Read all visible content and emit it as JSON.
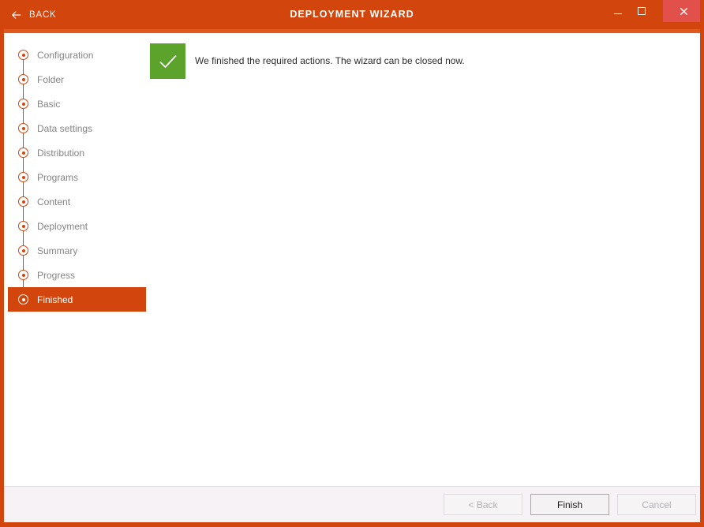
{
  "titlebar": {
    "back_label": "BACK",
    "back_icon": "arrow-left-icon",
    "title": "DEPLOYMENT WIZARD",
    "minimize_icon": "minimize-icon",
    "maximize_icon": "maximize-icon",
    "close_icon": "close-icon",
    "bg_color": "#d2450c",
    "close_bg_color": "#e2504c"
  },
  "sidebar": {
    "steps": [
      {
        "label": "Configuration",
        "active": false
      },
      {
        "label": "Folder",
        "active": false
      },
      {
        "label": "Basic",
        "active": false
      },
      {
        "label": "Data settings",
        "active": false
      },
      {
        "label": "Distribution",
        "active": false
      },
      {
        "label": "Programs",
        "active": false
      },
      {
        "label": "Content",
        "active": false
      },
      {
        "label": "Deployment",
        "active": false
      },
      {
        "label": "Summary",
        "active": false
      },
      {
        "label": "Progress",
        "active": false
      },
      {
        "label": "Finished",
        "active": true
      }
    ],
    "accent_color": "#d2450c",
    "inactive_text_color": "#848484"
  },
  "main": {
    "status_icon": "checkmark-icon",
    "status_color": "#5ba32b",
    "message": "We finished the required actions. The wizard can be closed now."
  },
  "footer": {
    "buttons": [
      {
        "label": "< Back",
        "enabled": false
      },
      {
        "label": "Finish",
        "enabled": true
      },
      {
        "label": "Cancel",
        "enabled": false
      }
    ]
  }
}
